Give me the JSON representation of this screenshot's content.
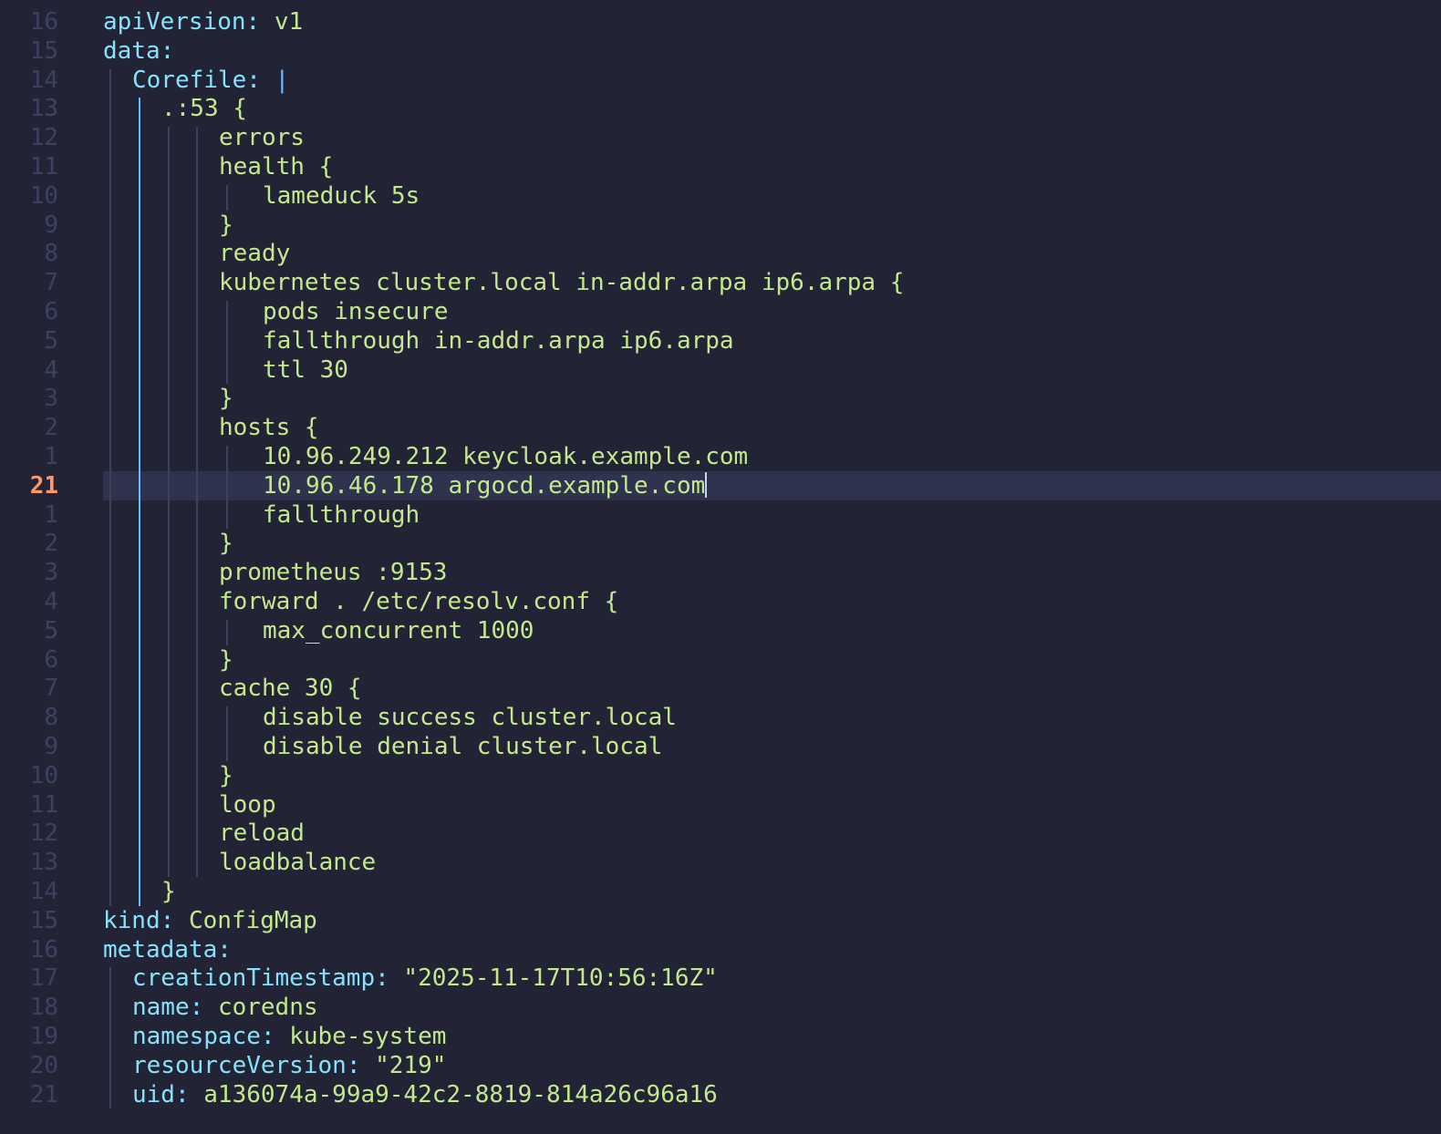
{
  "editor": {
    "colors": {
      "background": "#222436",
      "line_number": "#3b4261",
      "current_line_number": "#ff966c",
      "key": "#86e1fc",
      "string": "#c3e88d",
      "indent_guide": "#3b4261",
      "active_indent_guide": "#65bcff",
      "current_line_bg": "#2f334d"
    },
    "lines": [
      {
        "ln": "16",
        "indent": 0,
        "key": "apiVersion",
        "sep": ": ",
        "value": "v1"
      },
      {
        "ln": "15",
        "indent": 0,
        "key": "data",
        "sep": ":",
        "value": ""
      },
      {
        "ln": "14",
        "indent": 1,
        "key": "Corefile",
        "sep": ": ",
        "pipe": "|",
        "value": ""
      },
      {
        "ln": "13",
        "indent": 2,
        "text": ".:53 {"
      },
      {
        "ln": "12",
        "indent": 4,
        "text": "errors"
      },
      {
        "ln": "11",
        "indent": 4,
        "text": "health {"
      },
      {
        "ln": "10",
        "indent": 5,
        "text": "lameduck 5s"
      },
      {
        "ln": "9",
        "indent": 4,
        "text": "}"
      },
      {
        "ln": "8",
        "indent": 4,
        "text": "ready"
      },
      {
        "ln": "7",
        "indent": 4,
        "text": "kubernetes cluster.local in-addr.arpa ip6.arpa {"
      },
      {
        "ln": "6",
        "indent": 5,
        "text": "pods insecure"
      },
      {
        "ln": "5",
        "indent": 5,
        "text": "fallthrough in-addr.arpa ip6.arpa"
      },
      {
        "ln": "4",
        "indent": 5,
        "text": "ttl 30"
      },
      {
        "ln": "3",
        "indent": 4,
        "text": "}"
      },
      {
        "ln": "2",
        "indent": 4,
        "text": "hosts {"
      },
      {
        "ln": "1",
        "indent": 5,
        "text": "10.96.249.212 keycloak.example.com"
      },
      {
        "ln": "21",
        "indent": 5,
        "text": "10.96.46.178 argocd.example.com",
        "current": true
      },
      {
        "ln": "1",
        "indent": 5,
        "text": "fallthrough"
      },
      {
        "ln": "2",
        "indent": 4,
        "text": "}"
      },
      {
        "ln": "3",
        "indent": 4,
        "text": "prometheus :9153"
      },
      {
        "ln": "4",
        "indent": 4,
        "text": "forward . /etc/resolv.conf {"
      },
      {
        "ln": "5",
        "indent": 5,
        "text": "max_concurrent 1000"
      },
      {
        "ln": "6",
        "indent": 4,
        "text": "}"
      },
      {
        "ln": "7",
        "indent": 4,
        "text": "cache 30 {"
      },
      {
        "ln": "8",
        "indent": 5,
        "text": "disable success cluster.local"
      },
      {
        "ln": "9",
        "indent": 5,
        "text": "disable denial cluster.local"
      },
      {
        "ln": "10",
        "indent": 4,
        "text": "}"
      },
      {
        "ln": "11",
        "indent": 4,
        "text": "loop"
      },
      {
        "ln": "12",
        "indent": 4,
        "text": "reload"
      },
      {
        "ln": "13",
        "indent": 4,
        "text": "loadbalance"
      },
      {
        "ln": "14",
        "indent": 2,
        "text": "}"
      },
      {
        "ln": "15",
        "indent": 0,
        "key": "kind",
        "sep": ": ",
        "value": "ConfigMap"
      },
      {
        "ln": "16",
        "indent": 0,
        "key": "metadata",
        "sep": ":",
        "value": ""
      },
      {
        "ln": "17",
        "indent": 1,
        "key": "creationTimestamp",
        "sep": ": ",
        "value": "\"2025-11-17T10:56:16Z\""
      },
      {
        "ln": "18",
        "indent": 1,
        "key": "name",
        "sep": ": ",
        "value": "coredns"
      },
      {
        "ln": "19",
        "indent": 1,
        "key": "namespace",
        "sep": ": ",
        "value": "kube-system"
      },
      {
        "ln": "20",
        "indent": 1,
        "key": "resourceVersion",
        "sep": ": ",
        "value": "\"219\""
      },
      {
        "ln": "21",
        "indent": 1,
        "key": "uid",
        "sep": ": ",
        "value": "a136074a-99a9-42c2-8819-814a26c96a16"
      }
    ]
  }
}
